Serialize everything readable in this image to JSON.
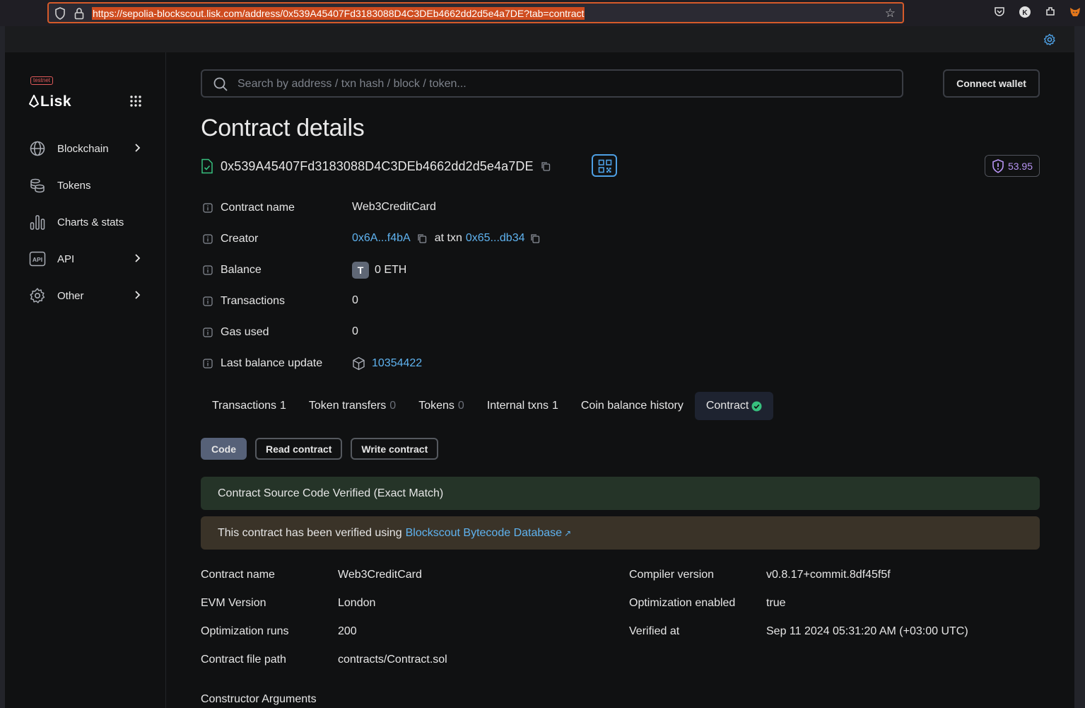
{
  "browser": {
    "url": "https://sepolia-blockscout.lisk.com/address/0x539A45407Fd3183088D4C3DEb4662dd2d5e4a7DE?tab=contract"
  },
  "sidebar": {
    "badge": "testnet",
    "logo": "Lisk",
    "items": [
      {
        "label": "Blockchain",
        "icon": "globe-icon",
        "has_chevron": true
      },
      {
        "label": "Tokens",
        "icon": "coins-icon",
        "has_chevron": false
      },
      {
        "label": "Charts & stats",
        "icon": "chart-icon",
        "has_chevron": false
      },
      {
        "label": "API",
        "icon": "api-icon",
        "has_chevron": true
      },
      {
        "label": "Other",
        "icon": "gear-icon",
        "has_chevron": true
      }
    ]
  },
  "header": {
    "search_placeholder": "Search by address / txn hash / block / token...",
    "connect_label": "Connect wallet"
  },
  "page": {
    "title": "Contract details",
    "address": "0x539A45407Fd3183088D4C3DEb4662dd2d5e4a7DE",
    "score": "53.95"
  },
  "info": {
    "contract_name": {
      "label": "Contract name",
      "value": "Web3CreditCard"
    },
    "creator": {
      "label": "Creator",
      "address": "0x6A...f4bA",
      "at_txn": "at txn",
      "txn": "0x65...db34"
    },
    "balance": {
      "label": "Balance",
      "token_letter": "T",
      "value": "0 ETH"
    },
    "transactions": {
      "label": "Transactions",
      "value": "0"
    },
    "gas_used": {
      "label": "Gas used",
      "value": "0"
    },
    "last_balance_update": {
      "label": "Last balance update",
      "value": "10354422"
    }
  },
  "tabs": [
    {
      "label": "Transactions",
      "count": "1",
      "count_muted": false
    },
    {
      "label": "Token transfers",
      "count": "0",
      "count_muted": true
    },
    {
      "label": "Tokens",
      "count": "0",
      "count_muted": true
    },
    {
      "label": "Internal txns",
      "count": "1",
      "count_muted": false
    },
    {
      "label": "Coin balance history",
      "count": "",
      "count_muted": false
    },
    {
      "label": "Contract",
      "count": "",
      "active": true
    }
  ],
  "subtabs": [
    "Code",
    "Read contract",
    "Write contract"
  ],
  "alerts": {
    "verified": "Contract Source Code Verified (Exact Match)",
    "db_prefix": "This contract has been verified using",
    "db_link": "Blockscout Bytecode Database"
  },
  "details": {
    "left": [
      {
        "label": "Contract name",
        "value": "Web3CreditCard"
      },
      {
        "label": "EVM Version",
        "value": "London"
      },
      {
        "label": "Optimization runs",
        "value": "200"
      },
      {
        "label": "Contract file path",
        "value": "contracts/Contract.sol"
      }
    ],
    "right": [
      {
        "label": "Compiler version",
        "value": "v0.8.17+commit.8df45f5f"
      },
      {
        "label": "Optimization enabled",
        "value": "true"
      },
      {
        "label": "Verified at",
        "value": "Sep 11 2024 05:31:20 AM (+03:00 UTC)"
      }
    ],
    "constructor_label": "Constructor Arguments"
  },
  "colors": {
    "link": "#5fb3f0",
    "verified_bg": "#253428",
    "info_bg": "#3a3328",
    "check": "#37c07e",
    "score": "#b794f4"
  }
}
